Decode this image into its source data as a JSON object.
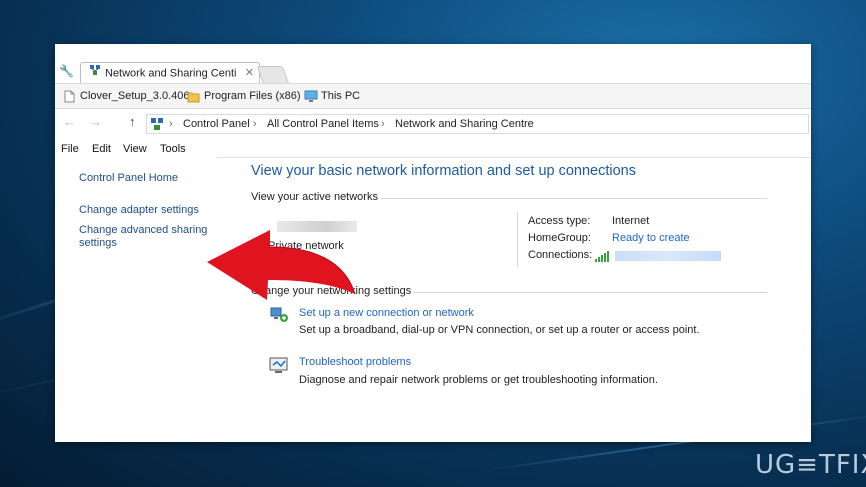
{
  "browser": {
    "tab_title": "Network and Sharing Centi",
    "tab_close": "✕"
  },
  "favorites": [
    {
      "label": "Clover_Setup_3.0.406",
      "icon": "file-icon"
    },
    {
      "label": "Program Files (x86)",
      "icon": "folder-icon"
    },
    {
      "label": "This PC",
      "icon": "computer-icon"
    }
  ],
  "address": {
    "back": "←",
    "forward": "→",
    "up": "↑",
    "crumbs": [
      "Control Panel",
      "All Control Panel Items",
      "Network and Sharing Centre"
    ],
    "sep": "›"
  },
  "menu": [
    "File",
    "Edit",
    "View",
    "Tools"
  ],
  "sidebar": {
    "links": [
      "Control Panel Home",
      "Change adapter settings",
      "Change advanced sharing settings"
    ]
  },
  "main": {
    "title": "View your basic network information and set up connections",
    "active_networks_heading": "View your active networks",
    "network_type": "Private network",
    "access_type_label": "Access type:",
    "access_type_value": "Internet",
    "homegroup_label": "HomeGroup:",
    "homegroup_value": "Ready to create",
    "connections_label": "Connections:",
    "change_heading": "Change your networking settings",
    "items": [
      {
        "title": "Set up a new connection or network",
        "desc": "Set up a broadband, dial-up or VPN connection, or set up a router or access point."
      },
      {
        "title": "Troubleshoot problems",
        "desc": "Diagnose and repair network problems or get troubleshooting information."
      }
    ]
  },
  "watermark": "UG≡TFIX",
  "colors": {
    "link": "#1e66c8",
    "title": "#1e5aa0",
    "arrow": "#e0141f"
  }
}
